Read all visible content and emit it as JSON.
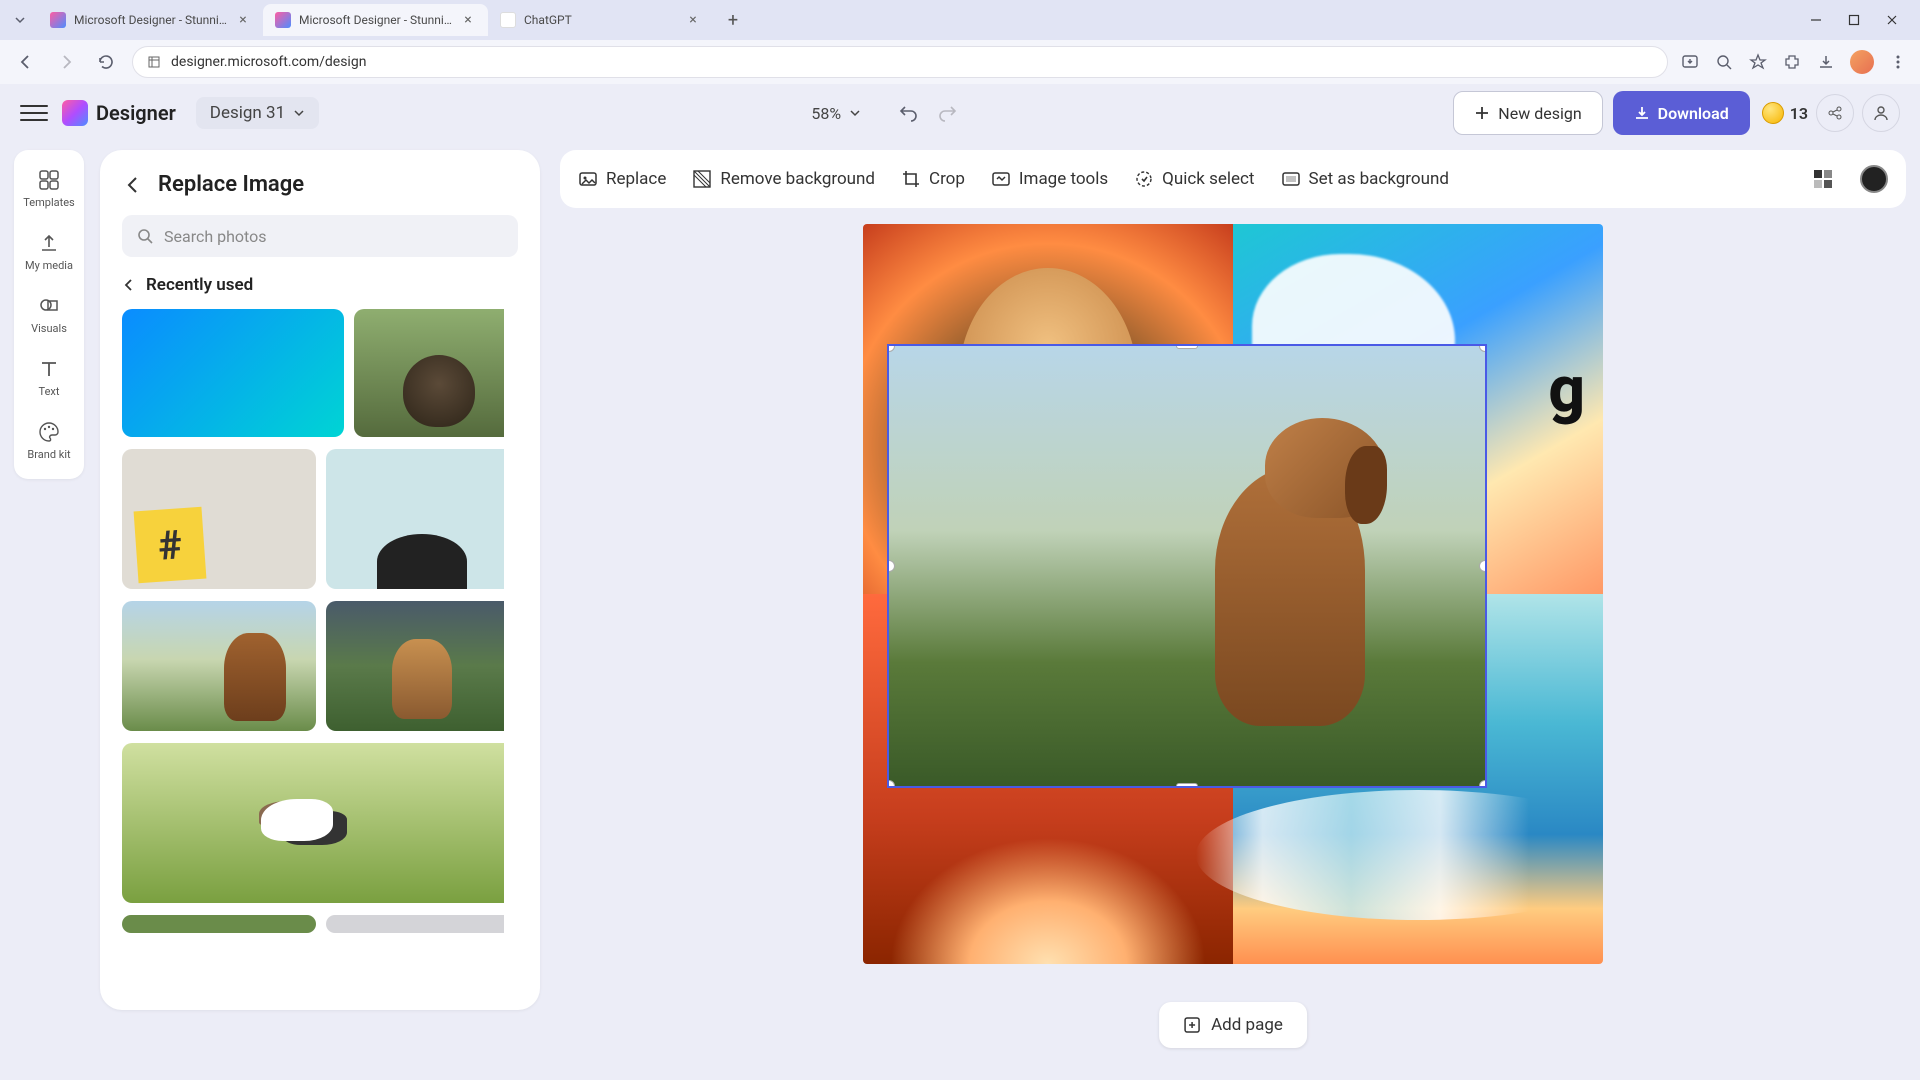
{
  "browser": {
    "tabs": [
      {
        "title": "Microsoft Designer - Stunning",
        "active": false
      },
      {
        "title": "Microsoft Designer - Stunning",
        "active": true
      },
      {
        "title": "ChatGPT",
        "active": false
      }
    ],
    "url": "designer.microsoft.com/design"
  },
  "header": {
    "brand": "Designer",
    "design_name": "Design 31",
    "zoom": "58%",
    "new_design": "New design",
    "download": "Download",
    "credits": "13"
  },
  "rail": {
    "templates": "Templates",
    "my_media": "My media",
    "visuals": "Visuals",
    "text": "Text",
    "brand_kit": "Brand kit"
  },
  "panel": {
    "title": "Replace Image",
    "search_placeholder": "Search photos",
    "recently_used": "Recently used"
  },
  "context_bar": {
    "replace": "Replace",
    "remove_bg": "Remove background",
    "crop": "Crop",
    "image_tools": "Image tools",
    "quick_select": "Quick select",
    "set_bg": "Set as background"
  },
  "canvas": {
    "title_fragment": "g",
    "add_page": "Add page"
  }
}
